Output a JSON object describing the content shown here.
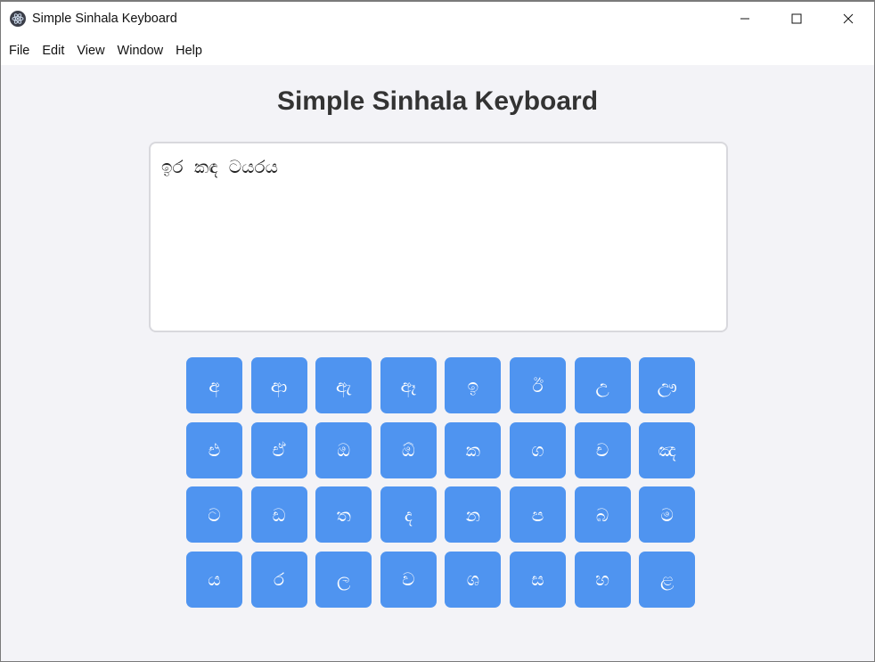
{
  "window": {
    "title": "Simple Sinhala Keyboard",
    "icon": "electron-atom-icon"
  },
  "menu": [
    "File",
    "Edit",
    "View",
    "Window",
    "Help"
  ],
  "page": {
    "heading": "Simple Sinhala Keyboard",
    "text_value": "ඉර කඳ ටයරය"
  },
  "keyboard": {
    "keys": [
      "අ",
      "ආ",
      "ඇ",
      "ඈ",
      "ඉ",
      "ඊ",
      "උ",
      "ඌ",
      "එ",
      "ඒ",
      "ඔ",
      "ඕ",
      "ක",
      "ග",
      "ච",
      "ඤ",
      "ට",
      "ඩ",
      "ත",
      "ද",
      "න",
      "ප",
      "බ",
      "ම",
      "ය",
      "ර",
      "ල",
      "ව",
      "ශ",
      "ස",
      "හ",
      "ළ"
    ]
  },
  "colors": {
    "key_bg": "#4f94f0",
    "page_bg": "#f3f3f7",
    "heading": "#333333"
  }
}
